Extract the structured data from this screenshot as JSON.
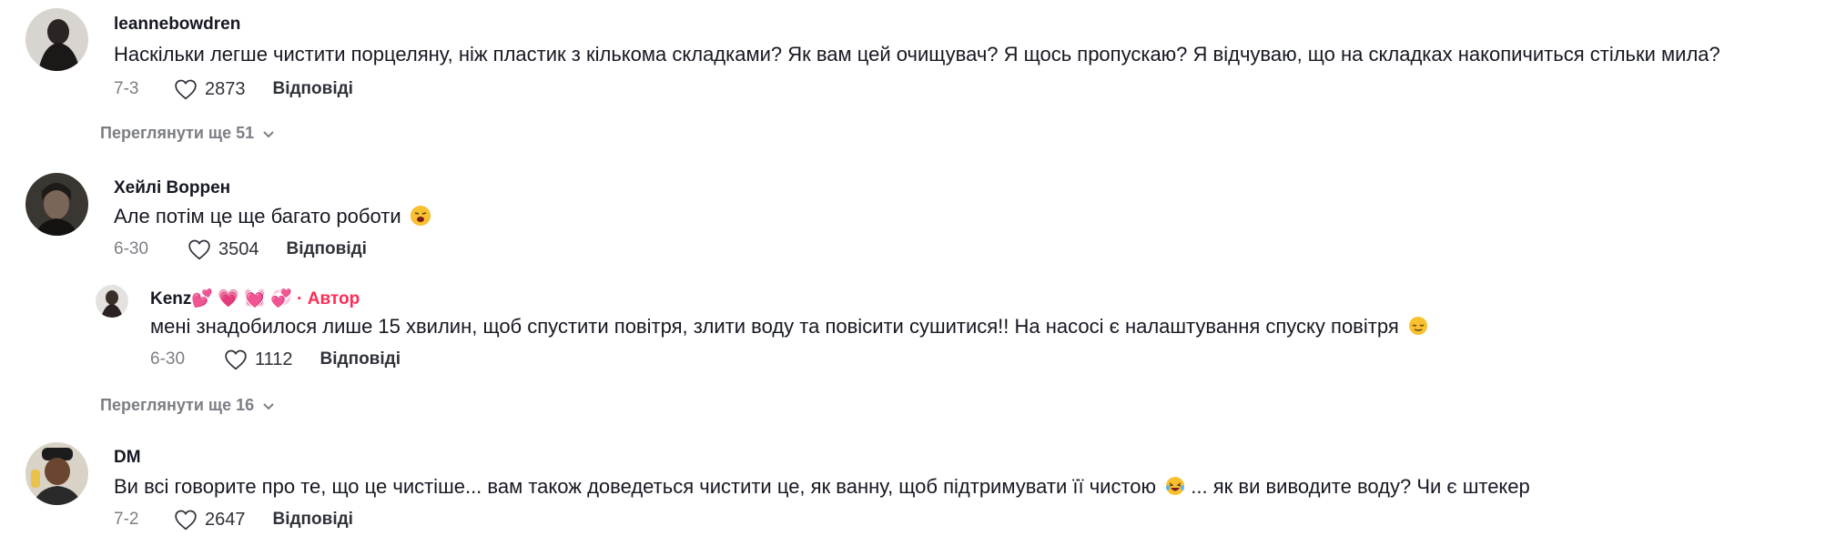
{
  "comments": [
    {
      "username": "leannebowdren",
      "text": "Наскільки легше чистити порцеляну, ніж пластик з кількома складками? Як вам цей очищувач? Я щось пропускаю? Я відчуваю, що на складках накопичиться стільки мила?",
      "date": "7-3",
      "likes": "2873",
      "reply_label": "Відповіді",
      "view_more": "Переглянути ще 51"
    },
    {
      "username": "Хейлі Воррен",
      "text": "Але потім це ще багато роботи",
      "date": "6-30",
      "likes": "3504",
      "reply_label": "Відповіді",
      "view_more": "Переглянути ще 16",
      "reply": {
        "username": "Kenz",
        "author_label": "· Автор",
        "text": "мені знадобилося лише 15 хвилин, щоб спустити повітря, злити воду та повісити сушитися!! На насосі є налаштування спуску повітря",
        "date": "6-30",
        "likes": "1112",
        "reply_label": "Відповіді"
      }
    },
    {
      "username": "DM",
      "text": "Ви всі говорите про те, що це чистіше... вам також доведеться чистити це, як ванну, щоб підтримувати її чистою",
      "text_tail": "... як ви виводите воду? Чи є штекер",
      "date": "7-2",
      "likes": "2647",
      "reply_label": "Відповіді"
    }
  ]
}
